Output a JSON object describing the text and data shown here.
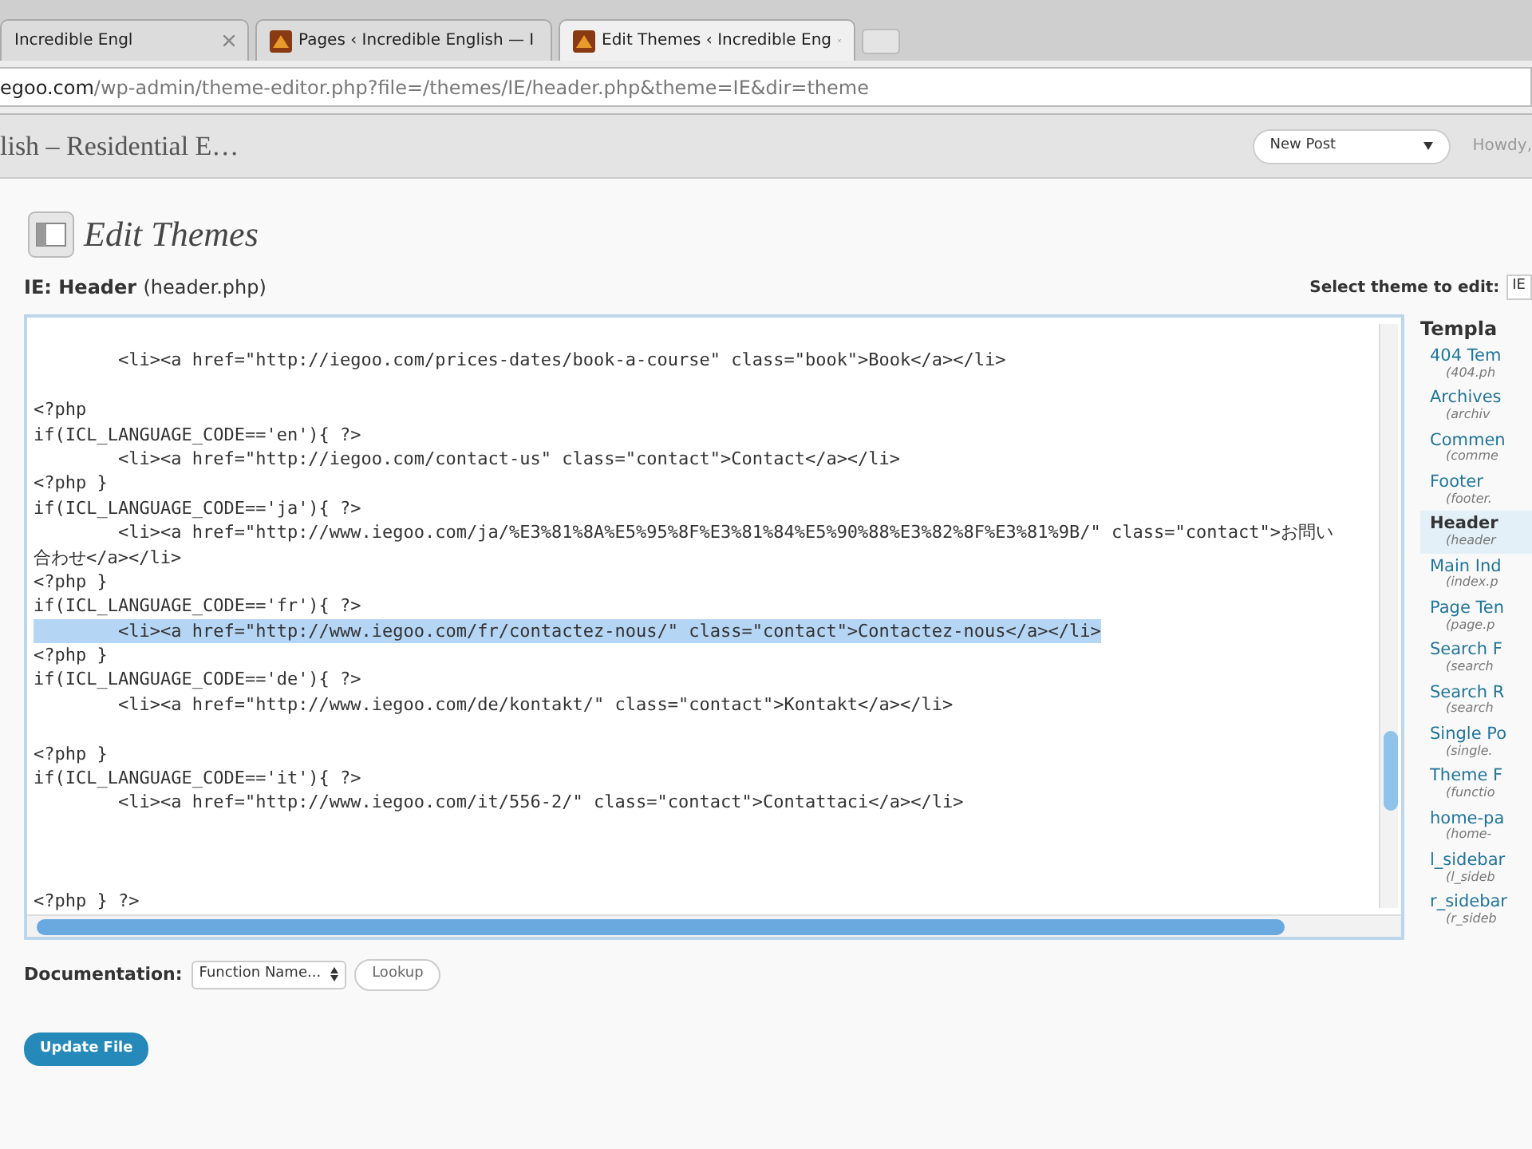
{
  "browser_tabs": [
    {
      "title": "Incredible Engl",
      "selected": false
    },
    {
      "title": "Pages ‹ Incredible English — I",
      "selected": false
    },
    {
      "title": "Edit Themes ‹ Incredible Eng",
      "selected": true
    }
  ],
  "address_bar": {
    "url_host": "egoo.com",
    "url_path": "/wp-admin/theme-editor.php?file=/themes/IE/header.php&theme=IE&dir=theme"
  },
  "admin_header": {
    "site_title": "lish – Residential E…",
    "new_post": "New Post",
    "howdy": "Howdy,"
  },
  "page_title": "Edit Themes",
  "file_heading": {
    "name": "IE: Header",
    "file": "(header.php)"
  },
  "select_theme": {
    "label": "Select theme to edit:",
    "value": "IE"
  },
  "code_lines": [
    {
      "selected": false
    },
    {
      "text": "        <li><a href=\"http://iegoo.com/prices-dates/book-a-course\" class=\"book\">Book</a></li>",
      "selected": false
    },
    {
      "selected": false
    },
    {
      "text": "<?php",
      "selected": false
    },
    {
      "text": "if(ICL_LANGUAGE_CODE=='en'){ ?>",
      "selected": false
    },
    {
      "text": "        <li><a href=\"http://iegoo.com/contact-us\" class=\"contact\">Contact</a></li>",
      "selected": false
    },
    {
      "text": "<?php }",
      "selected": false
    },
    {
      "text": "if(ICL_LANGUAGE_CODE=='ja'){ ?>",
      "selected": false
    },
    {
      "text": "        <li><a href=\"http://www.iegoo.com/ja/%E3%81%8A%E5%95%8F%E3%81%84%E5%90%88%E3%82%8F%E3%81%9B/\" class=\"contact\">お問い",
      "selected": false
    },
    {
      "text": "合わせ</a></li>",
      "selected": false
    },
    {
      "text": "<?php }",
      "selected": false
    },
    {
      "text": "if(ICL_LANGUAGE_CODE=='fr'){ ?>",
      "selected": false
    },
    {
      "text": "        <li><a href=\"http://www.iegoo.com/fr/contactez-nous/\" class=\"contact\">Contactez-nous</a></li>",
      "selected": true
    },
    {
      "text": "<?php }",
      "selected": false
    },
    {
      "text": "if(ICL_LANGUAGE_CODE=='de'){ ?>",
      "selected": false
    },
    {
      "text": "        <li><a href=\"http://www.iegoo.com/de/kontakt/\" class=\"contact\">Kontakt</a></li>",
      "selected": false
    },
    {
      "selected": false
    },
    {
      "text": "<?php }",
      "selected": false
    },
    {
      "text": "if(ICL_LANGUAGE_CODE=='it'){ ?>",
      "selected": false
    },
    {
      "text": "        <li><a href=\"http://www.iegoo.com/it/556-2/\" class=\"contact\">Contattaci</a></li>",
      "selected": false
    },
    {
      "selected": false
    },
    {
      "selected": false
    },
    {
      "selected": false
    },
    {
      "text": "<?php } ?>",
      "selected": false
    }
  ],
  "documentation": {
    "label": "Documentation:",
    "select": "Function Name...",
    "lookup": "Lookup"
  },
  "update_button": "Update File",
  "templates": {
    "title": "Templa",
    "items": [
      {
        "name": "404 Tem",
        "file": "(404.ph",
        "selected": false
      },
      {
        "name": "Archives",
        "file": "(archiv",
        "selected": false
      },
      {
        "name": "Commen",
        "file": "(comme",
        "selected": false
      },
      {
        "name": "Footer",
        "file": "(footer.",
        "selected": false
      },
      {
        "name": "Header",
        "file": "(header",
        "selected": true
      },
      {
        "name": "Main Ind",
        "file": "(index.p",
        "selected": false
      },
      {
        "name": "Page Ten",
        "file": "(page.p",
        "selected": false
      },
      {
        "name": "Search F",
        "file": "(search",
        "selected": false
      },
      {
        "name": "Search R",
        "file": "(search",
        "selected": false
      },
      {
        "name": "Single Po",
        "file": "(single.",
        "selected": false
      },
      {
        "name": "Theme F",
        "file": "(functio",
        "selected": false
      },
      {
        "name": "home-pa",
        "file": "(home-",
        "selected": false
      },
      {
        "name": "l_sidebar",
        "file": "(l_sideb",
        "selected": false
      },
      {
        "name": "r_sidebar",
        "file": "(r_sideb",
        "selected": false
      }
    ]
  }
}
